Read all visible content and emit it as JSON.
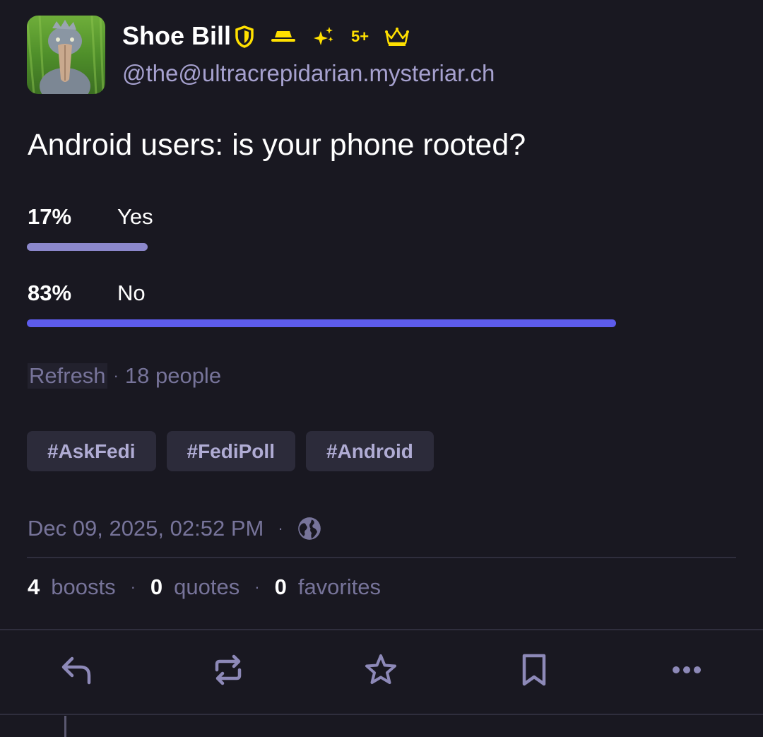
{
  "author": {
    "display_name": "Shoe Bill",
    "handle": "@the@ultracrepidarian.mysteriar.ch",
    "avatar_icon": "shoebill-photo",
    "badges": [
      {
        "icon": "shield-icon"
      },
      {
        "icon": "hat-icon"
      },
      {
        "icon": "sparkles-icon"
      },
      {
        "text": "5+"
      },
      {
        "icon": "crown-icon"
      }
    ],
    "badge_color": "#ffe000"
  },
  "post": {
    "text": "Android users: is your phone rooted?"
  },
  "poll": {
    "options": [
      {
        "percent_label": "17%",
        "label": "Yes",
        "fraction": 0.17,
        "bar_color": "#8c88cc"
      },
      {
        "percent_label": "83%",
        "label": "No",
        "fraction": 0.83,
        "bar_color": "#5d5cec"
      }
    ],
    "refresh_label": "Refresh",
    "separator": "·",
    "voters": "18 people"
  },
  "tags": [
    "#AskFedi",
    "#FediPoll",
    "#Android"
  ],
  "meta": {
    "datetime": "Dec 09, 2025, 02:52 PM",
    "separator": "·",
    "visibility_icon": "globe-icon"
  },
  "stats": {
    "boosts_count": "4",
    "boosts_label": "boosts",
    "quotes_count": "0",
    "quotes_label": "quotes",
    "favorites_count": "0",
    "favorites_label": "favorites",
    "separator": "·"
  },
  "actions": [
    {
      "icon": "reply-icon"
    },
    {
      "icon": "boost-icon"
    },
    {
      "icon": "star-icon"
    },
    {
      "icon": "bookmark-icon"
    },
    {
      "icon": "more-icon"
    }
  ],
  "colors": {
    "background": "#191821",
    "muted": "#77749a",
    "handle": "#a6a1cf",
    "tag_bg": "#2c2b3a",
    "tag_text": "#b0acd4",
    "icon": "#8d89b8"
  }
}
